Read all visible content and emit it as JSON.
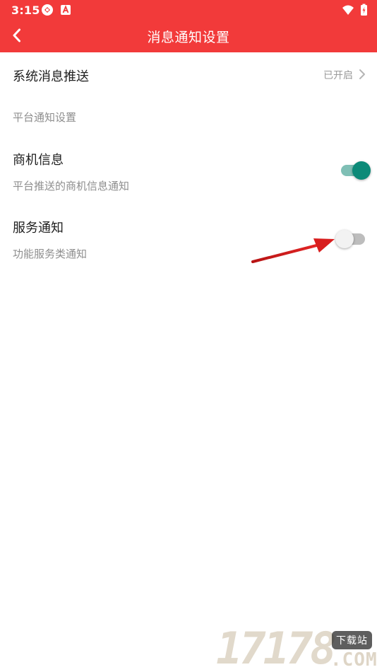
{
  "status_bar": {
    "time": "3:15",
    "icons": [
      "sync-icon",
      "a-badge-icon",
      "wifi-icon",
      "battery-charging-icon"
    ]
  },
  "app_bar": {
    "title": "消息通知设置",
    "back_icon": "chevron-left-icon"
  },
  "settings": {
    "system_push": {
      "title": "系统消息推送",
      "value": "已开启"
    },
    "section_header": "平台通知设置",
    "business_info": {
      "title": "商机信息",
      "subtitle": "平台推送的商机信息通知",
      "enabled": true
    },
    "service_notice": {
      "title": "服务通知",
      "subtitle": "功能服务类通知",
      "enabled": false
    }
  },
  "watermark": {
    "digits": "17178",
    "site": "下载站",
    "com": ".COM"
  },
  "colors": {
    "header_red": "#f23a3a",
    "toggle_on": "#0c8a78",
    "toggle_on_track": "#7fbfb5",
    "toggle_off_track": "#bdbdbd",
    "annotation_arrow": "#d81e1e"
  }
}
